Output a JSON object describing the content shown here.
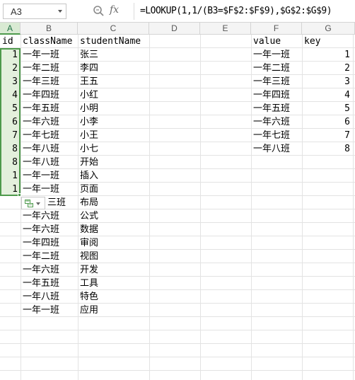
{
  "formula_bar": {
    "name_box": "A3",
    "zoom_icon": "magnifier-icon",
    "fx_label": "fx",
    "formula": "=LOOKUP(1,1/(B3=$F$2:$F$9),$G$2:$G$9)"
  },
  "columns": [
    "A",
    "B",
    "C",
    "D",
    "E",
    "F",
    "G"
  ],
  "headers": {
    "a": "id",
    "b": "className",
    "c": "studentName",
    "f": "value",
    "g": "key"
  },
  "rows": [
    {
      "id": "1",
      "className": "一年一班",
      "studentName": "张三"
    },
    {
      "id": "2",
      "className": "一年二班",
      "studentName": "李四"
    },
    {
      "id": "3",
      "className": "一年三班",
      "studentName": "王五"
    },
    {
      "id": "4",
      "className": "一年四班",
      "studentName": "小红"
    },
    {
      "id": "5",
      "className": "一年五班",
      "studentName": "小明"
    },
    {
      "id": "6",
      "className": "一年六班",
      "studentName": "小李"
    },
    {
      "id": "7",
      "className": "一年七班",
      "studentName": "小王"
    },
    {
      "id": "8",
      "className": "一年八班",
      "studentName": "小七"
    },
    {
      "id": "8",
      "className": "一年八班",
      "studentName": "开始"
    },
    {
      "id": "1",
      "className": "一年一班",
      "studentName": "插入"
    },
    {
      "id": "1",
      "className": "一年一班",
      "studentName": "页面"
    },
    {
      "id": "",
      "className": "三班",
      "studentName": "布局"
    },
    {
      "id": "",
      "className": "一年六班",
      "studentName": "公式"
    },
    {
      "id": "",
      "className": "一年六班",
      "studentName": "数据"
    },
    {
      "id": "",
      "className": "一年四班",
      "studentName": "审阅"
    },
    {
      "id": "",
      "className": "一年二班",
      "studentName": "视图"
    },
    {
      "id": "",
      "className": "一年六班",
      "studentName": "开发"
    },
    {
      "id": "",
      "className": "一年五班",
      "studentName": "工具"
    },
    {
      "id": "",
      "className": "一年八班",
      "studentName": "特色"
    },
    {
      "id": "",
      "className": "一年一班",
      "studentName": "应用"
    }
  ],
  "lookup_table": [
    {
      "value": "一年一班",
      "key": "1"
    },
    {
      "value": "一年二班",
      "key": "2"
    },
    {
      "value": "一年三班",
      "key": "3"
    },
    {
      "value": "一年四班",
      "key": "4"
    },
    {
      "value": "一年五班",
      "key": "5"
    },
    {
      "value": "一年六班",
      "key": "6"
    },
    {
      "value": "一年七班",
      "key": "7"
    },
    {
      "value": "一年八班",
      "key": "8"
    }
  ],
  "autofill_icon": "autofill-options-icon",
  "colors": {
    "selection_border": "#4e9a4c",
    "selection_fill": "#e3f0dc",
    "header_bg": "#f4f4f4"
  }
}
